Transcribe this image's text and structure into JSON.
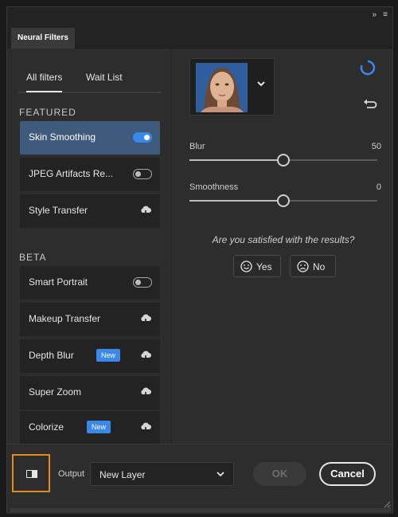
{
  "window": {
    "title": "Neural Filters"
  },
  "titlebar": {
    "collapse_label": "»",
    "menu_label": "≡"
  },
  "filter_tabs": {
    "all": "All filters",
    "wait": "Wait List"
  },
  "sections": {
    "featured": "FEATURED",
    "beta": "BETA"
  },
  "filters": [
    {
      "label": "Skin Smoothing",
      "control": "toggle",
      "on": true,
      "selected": true
    },
    {
      "label": "JPEG Artifacts Re...",
      "control": "toggle",
      "on": false
    },
    {
      "label": "Style Transfer",
      "control": "cloud"
    },
    {
      "label": "Smart Portrait",
      "control": "toggle",
      "on": false
    },
    {
      "label": "Makeup Transfer",
      "control": "cloud"
    },
    {
      "label": "Depth Blur",
      "control": "cloud",
      "badge": "New"
    },
    {
      "label": "Super Zoom",
      "control": "cloud"
    },
    {
      "label": "Colorize",
      "control": "cloud",
      "badge": "New"
    }
  ],
  "sliders": [
    {
      "label": "Blur",
      "value": "50",
      "fraction": 0.5
    },
    {
      "label": "Smoothness",
      "value": "0",
      "fraction": 0.5
    }
  ],
  "feedback": {
    "question": "Are you satisfied with the results?",
    "yes": "Yes",
    "no": "No"
  },
  "footer": {
    "output_label": "Output",
    "output_value": "New Layer",
    "ok": "OK",
    "cancel": "Cancel"
  },
  "colors": {
    "accent": "#3b88eb",
    "highlight": "#e38b1a",
    "selected_row": "#3f5a7d"
  }
}
